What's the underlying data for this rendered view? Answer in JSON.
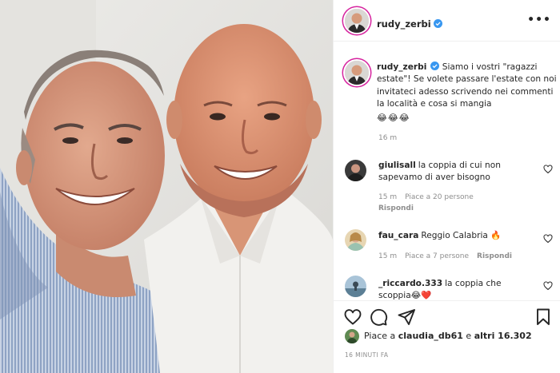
{
  "post": {
    "author": "rudy_zerbi",
    "caption": "Siamo i vostri \"ragazzi estate\"! Se volete passare l'estate con noi invitateci adesso scrivendo nei commenti la località e cosa si mangia",
    "caption_emoji": "😂😂😂",
    "caption_time": "16 m"
  },
  "comments": [
    {
      "username": "giulisall",
      "text": "la coppia di cui non sapevamo di aver bisogno",
      "time": "15 m",
      "likes": "Piace a 20 persone",
      "reply": "Rispondi"
    },
    {
      "username": "fau_cara",
      "text": "Reggio Calabria 🔥",
      "time": "15 m",
      "likes": "Piace a 7 persone",
      "reply": "Rispondi"
    },
    {
      "username": "_riccardo.333",
      "text": "la coppia che scoppia😂❤️"
    }
  ],
  "likes_summary": {
    "prefix": "Piace a ",
    "user": "claudia_db61",
    "middle": " e ",
    "others": "altri 16.302"
  },
  "posted_time": "16 MINUTI FA",
  "colors": {
    "verified": "#3897f0",
    "muted_text": "#8e8e8e",
    "text": "#262626",
    "story_ring": "#d6249f"
  },
  "icons": {
    "more": "more-horizontal-icon",
    "like": "heart-icon",
    "comment": "comment-bubble-icon",
    "share": "paper-plane-icon",
    "save": "bookmark-icon",
    "verified": "verified-badge-icon"
  }
}
